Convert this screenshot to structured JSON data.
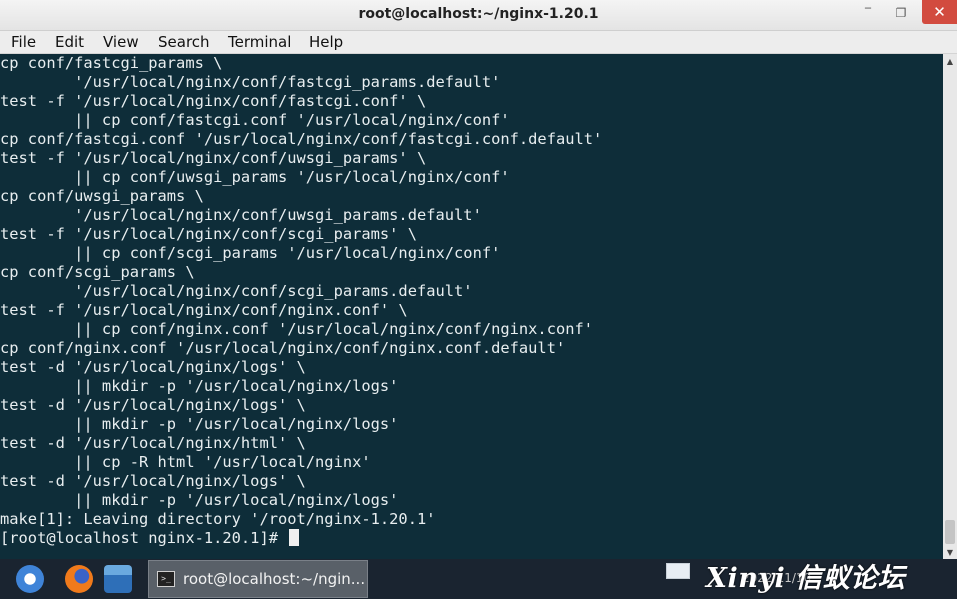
{
  "window": {
    "title": "root@localhost:~/nginx-1.20.1",
    "min_glyph": "‾",
    "max_glyph": "❐",
    "close_glyph": "✕"
  },
  "menubar": {
    "items": [
      "File",
      "Edit",
      "View",
      "Search",
      "Terminal",
      "Help"
    ]
  },
  "terminal": {
    "lines": [
      "cp conf/fastcgi_params \\",
      "        '/usr/local/nginx/conf/fastcgi_params.default'",
      "test -f '/usr/local/nginx/conf/fastcgi.conf' \\",
      "        || cp conf/fastcgi.conf '/usr/local/nginx/conf'",
      "cp conf/fastcgi.conf '/usr/local/nginx/conf/fastcgi.conf.default'",
      "test -f '/usr/local/nginx/conf/uwsgi_params' \\",
      "        || cp conf/uwsgi_params '/usr/local/nginx/conf'",
      "cp conf/uwsgi_params \\",
      "        '/usr/local/nginx/conf/uwsgi_params.default'",
      "test -f '/usr/local/nginx/conf/scgi_params' \\",
      "        || cp conf/scgi_params '/usr/local/nginx/conf'",
      "cp conf/scgi_params \\",
      "        '/usr/local/nginx/conf/scgi_params.default'",
      "test -f '/usr/local/nginx/conf/nginx.conf' \\",
      "        || cp conf/nginx.conf '/usr/local/nginx/conf/nginx.conf'",
      "cp conf/nginx.conf '/usr/local/nginx/conf/nginx.conf.default'",
      "test -d '/usr/local/nginx/logs' \\",
      "        || mkdir -p '/usr/local/nginx/logs'",
      "test -d '/usr/local/nginx/logs' \\",
      "        || mkdir -p '/usr/local/nginx/logs'",
      "test -d '/usr/local/nginx/html' \\",
      "        || cp -R html '/usr/local/nginx'",
      "test -d '/usr/local/nginx/logs' \\",
      "        || mkdir -p '/usr/local/nginx/logs'",
      "make[1]: Leaving directory '/root/nginx-1.20.1'"
    ],
    "prompt": "[root@localhost nginx-1.20.1]# "
  },
  "taskbar": {
    "task_label": "root@localhost:~/ngin...",
    "term_icon_glyph": ">_",
    "start_icon": "deepin-start-icon",
    "firefox_icon": "firefox-icon",
    "files_icon": "file-manager-icon",
    "desktop_icon": "show-desktop-icon",
    "clock": "2022/11/10",
    "watermark": "Xinyi 信蚁论坛"
  },
  "colors": {
    "terminal_bg": "#0e2d39",
    "terminal_fg": "#e8eef0",
    "close_btn": "#d24b3f",
    "taskbar_bg": "#1a2430"
  }
}
